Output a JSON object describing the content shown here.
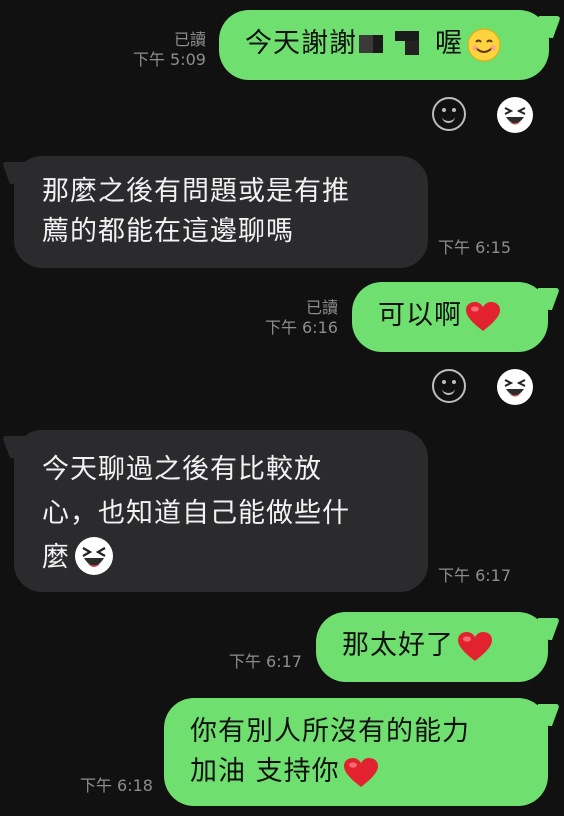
{
  "messages": [
    {
      "text_before": "今天謝謝",
      "text_after": "喔",
      "read": "已讀",
      "time": "下午 5:09"
    },
    {
      "line1": "那麼之後有問題或是有推",
      "line2": "薦的都能在這邊聊嗎",
      "time": "下午 6:15"
    },
    {
      "text": "可以啊",
      "read": "已讀",
      "time": "下午 6:16"
    },
    {
      "line1": "今天聊過之後有比較放",
      "line2": "心，也知道自己能做些什",
      "line3": "麼",
      "time": "下午 6:17"
    },
    {
      "text": "那太好了",
      "time": "下午 6:17"
    },
    {
      "line1": "你有別人所沒有的能力",
      "line2": "加油 支持你",
      "time": "下午 6:18"
    }
  ],
  "colors": {
    "background": "#111111",
    "outgoing_bubble": "#6fe06f",
    "incoming_bubble": "#2b2b2d",
    "meta_text": "#8d8d8d",
    "heart": "#e2222f"
  },
  "icons": [
    "smile-emoji-icon",
    "heart-icon",
    "laughing-sticker-icon",
    "add-reaction-icon"
  ]
}
